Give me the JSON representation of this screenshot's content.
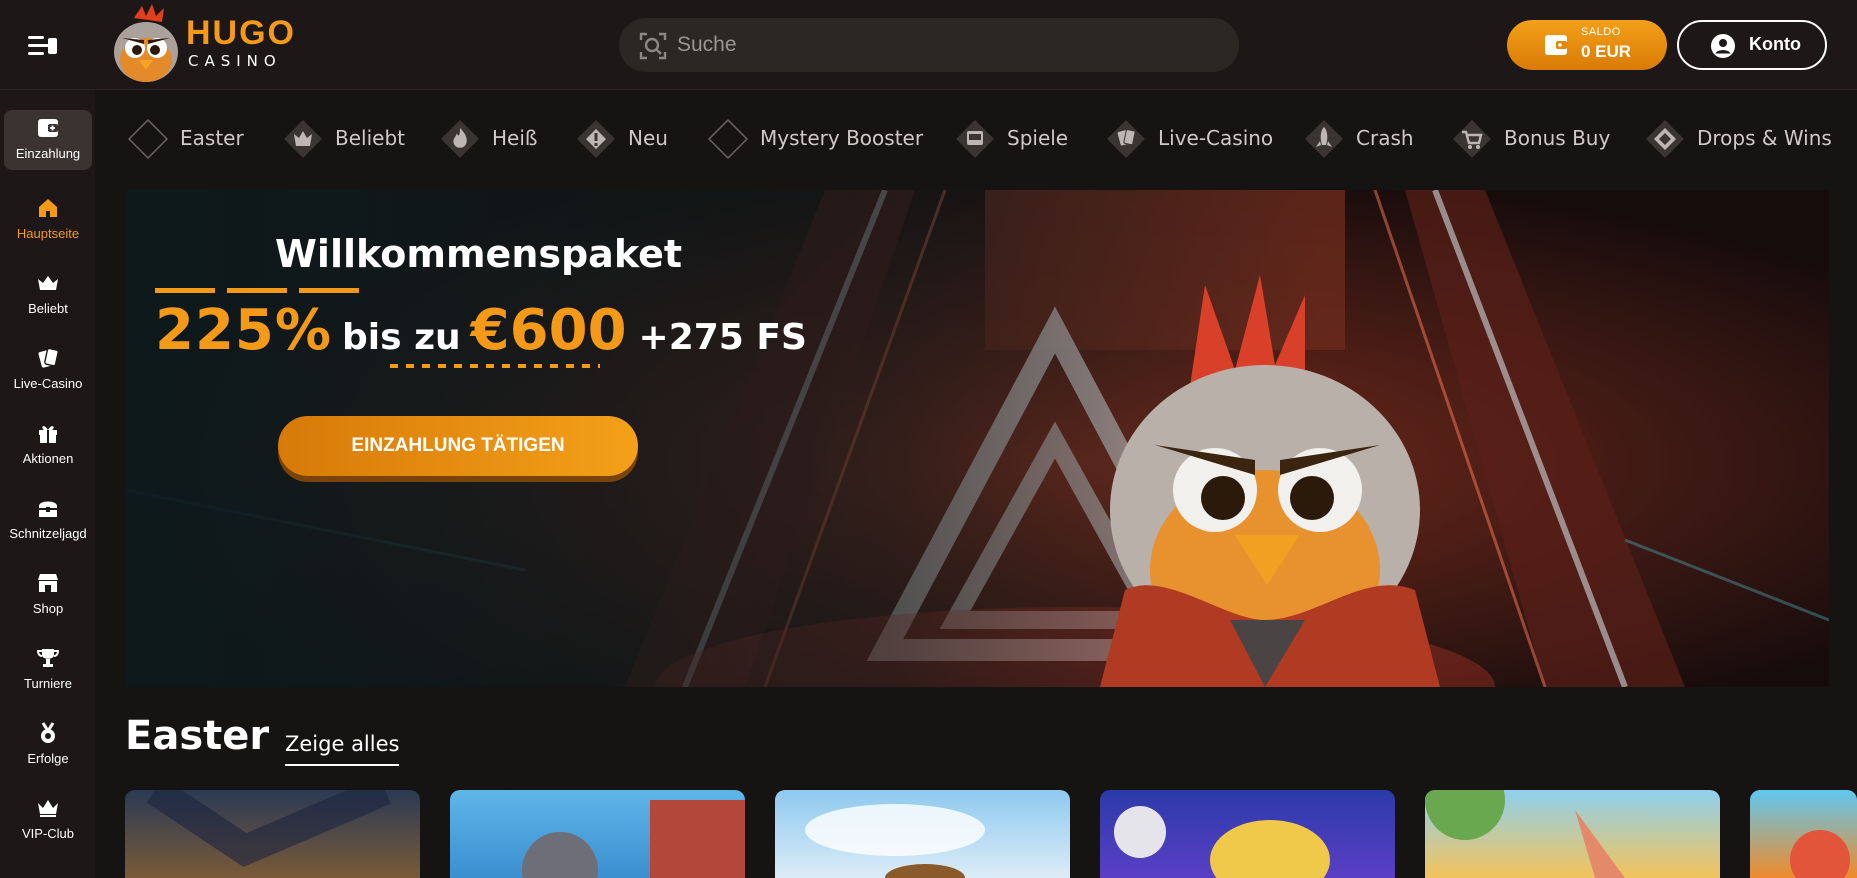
{
  "header": {
    "logo_primary": "HUGO",
    "logo_secondary": "CASINO",
    "search_placeholder": "Suche",
    "balance_label": "SALDO",
    "balance_value": "0 EUR",
    "account_label": "Konto"
  },
  "sidebar": {
    "items": [
      {
        "label": "Einzahlung",
        "icon": "deposit-icon"
      },
      {
        "label": "Hauptseite",
        "icon": "home-icon",
        "active": true
      },
      {
        "label": "Beliebt",
        "icon": "crown-icon"
      },
      {
        "label": "Live-Casino",
        "icon": "cards-icon"
      },
      {
        "label": "Aktionen",
        "icon": "gift-icon"
      },
      {
        "label": "Schnitzeljagd",
        "icon": "treasure-chest-icon"
      },
      {
        "label": "Shop",
        "icon": "shop-icon"
      },
      {
        "label": "Turniere",
        "icon": "trophy-icon"
      },
      {
        "label": "Erfolge",
        "icon": "medal-icon"
      },
      {
        "label": "VIP-Club",
        "icon": "vip-crown-icon"
      }
    ]
  },
  "categories": [
    {
      "label": "Easter"
    },
    {
      "label": "Beliebt"
    },
    {
      "label": "Heiß"
    },
    {
      "label": "Neu"
    },
    {
      "label": "Mystery Booster"
    },
    {
      "label": "Spiele"
    },
    {
      "label": "Live-Casino"
    },
    {
      "label": "Crash"
    },
    {
      "label": "Bonus Buy"
    },
    {
      "label": "Drops & Wins"
    }
  ],
  "hero": {
    "title": "Willkommenspaket",
    "percent": "225%",
    "middle": "bis zu",
    "amount": "€600",
    "free_spins": "+275 FS",
    "cta": "EINZAHLUNG TÄTIGEN"
  },
  "easter_section": {
    "title": "Easter",
    "see_all": "Zeige alles"
  },
  "colors": {
    "accent": "#f59a18",
    "background": "#161313",
    "header": "#1d1817"
  }
}
